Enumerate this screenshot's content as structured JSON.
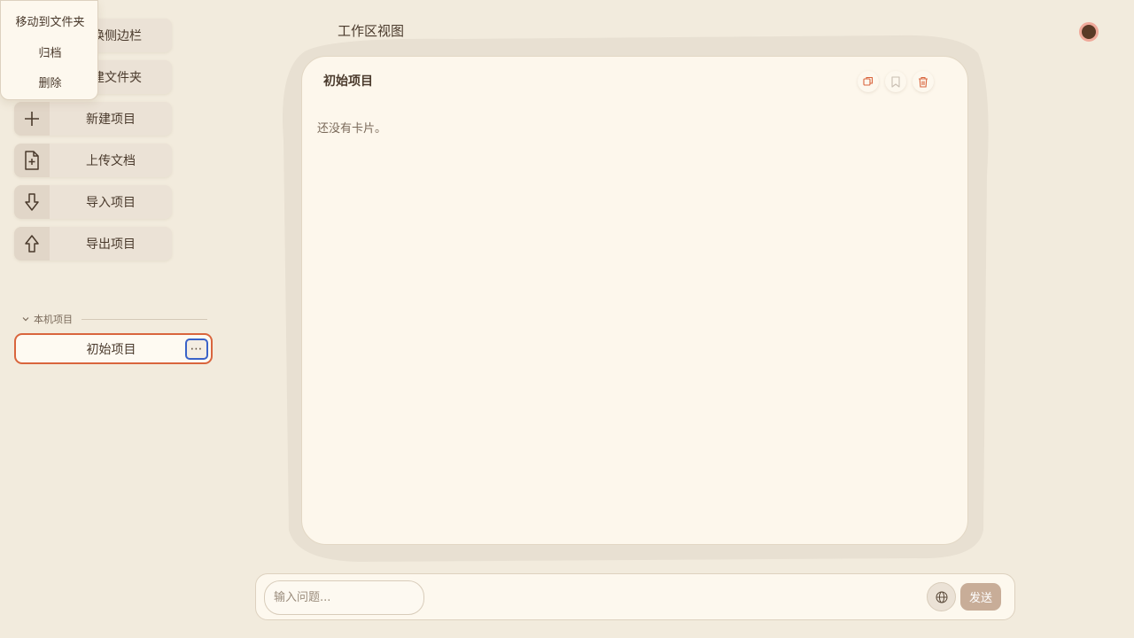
{
  "sidebar": {
    "buttons": [
      {
        "label": "切换侧边栏",
        "icon": "sidebar-icon"
      },
      {
        "label": "新建文件夹",
        "icon": "folder-plus-icon"
      },
      {
        "label": "新建项目",
        "icon": "plus-icon"
      },
      {
        "label": "上传文档",
        "icon": "file-plus-icon"
      },
      {
        "label": "导入项目",
        "icon": "arrow-down-icon"
      },
      {
        "label": "导出项目",
        "icon": "arrow-up-icon"
      }
    ],
    "section_label": "本机项目",
    "projects": [
      {
        "label": "初始项目",
        "more": "⋯"
      }
    ]
  },
  "popup_menu": {
    "items": [
      "移动到文件夹",
      "归档",
      "删除"
    ]
  },
  "workspace": {
    "title": "工作区视图",
    "card": {
      "title": "初始项目",
      "empty_text": "还没有卡片。",
      "actions": [
        "copy-icon",
        "bookmark-icon",
        "trash-icon"
      ]
    }
  },
  "chat": {
    "placeholder": "输入问题...",
    "send_label": "发送",
    "globe_icon": "globe-icon"
  },
  "colors": {
    "background": "#f2ebdd",
    "accent": "#d9653d",
    "focus": "#3a62c8",
    "send": "#c8ad98"
  }
}
